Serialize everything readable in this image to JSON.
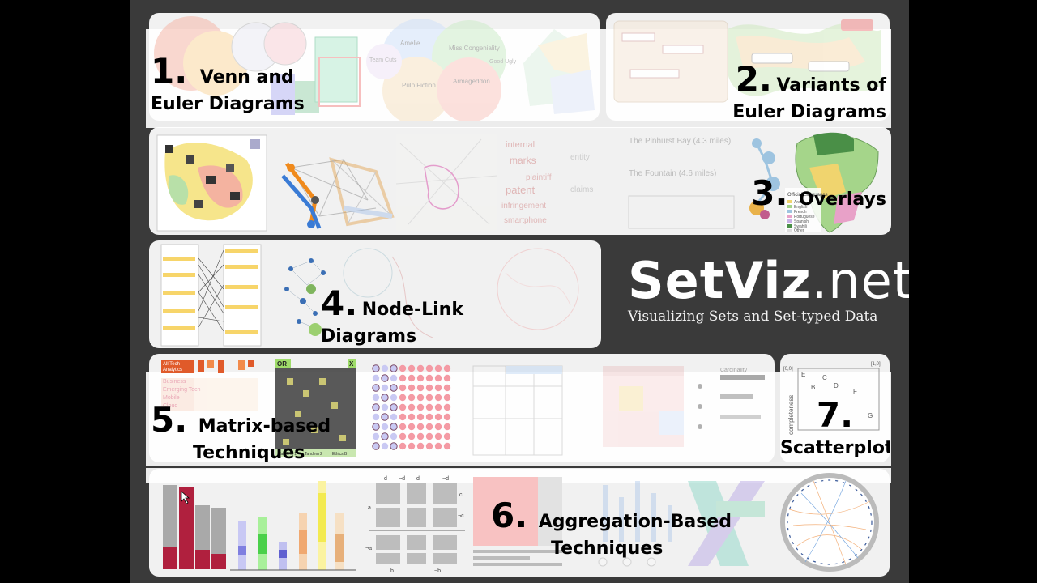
{
  "logo": {
    "name_part1": "SetViz",
    "name_part2": ".net",
    "tagline": "Visualizing Sets and Set-typed Data"
  },
  "categories": [
    {
      "number": "1.",
      "title_line1": "Venn and",
      "title_line2": "Euler Diagrams"
    },
    {
      "number": "2.",
      "title_line1": "Variants of",
      "title_line2": "Euler Diagrams"
    },
    {
      "number": "3.",
      "title_line1": "Overlays"
    },
    {
      "number": "4.",
      "title_line1": "Node-Link",
      "title_line2": "Diagrams"
    },
    {
      "number": "5.",
      "title_line1": "Matrix-based",
      "title_line2": "Techniques"
    },
    {
      "number": "6.",
      "title_line1": "Aggregation-Based",
      "title_line2": "Techniques"
    },
    {
      "number": "7.",
      "title_line1": "Scatterplots"
    }
  ],
  "thumbnails": {
    "venn_names": [
      "Amelie",
      "Miss Congeniality",
      "Pulp Fiction",
      "Armageddon",
      "Team Cuts",
      "Good Ugly"
    ],
    "word_cloud": [
      "internal",
      "marks",
      "plaintiff",
      "patent",
      "infringement",
      "smartphone"
    ],
    "route_list": [
      "The Pinhurst Bay (4.3 miles)",
      "The Fountain (4.6 miles)"
    ],
    "map_legend_title": "Official Languages",
    "map_legend": [
      "Arabic",
      "English",
      "French",
      "Portuguese",
      "Spanish",
      "Swahili",
      "Other"
    ],
    "matrix_header": [
      "All Tech",
      "Analytics"
    ],
    "matrix_rows": [
      "Business",
      "Emerging Tech",
      "Mobile",
      "Cloud"
    ],
    "bool_ops": [
      "OR",
      "X"
    ],
    "matrix_footer": [
      "Tandem 1",
      "Tandem 2",
      "Ethics B"
    ],
    "cardinality_label": "Cardinality",
    "scatter": {
      "ylabel": "completeness",
      "corner_left": "[0,0]",
      "corner_right": "[1,0]",
      "points": [
        "E",
        "C",
        "B",
        "D",
        "F",
        "G"
      ]
    },
    "aggregation_labels": [
      "d",
      "¬d",
      "d",
      "¬d",
      "c",
      "¬c",
      "a",
      "¬a",
      "b",
      "¬b"
    ]
  }
}
